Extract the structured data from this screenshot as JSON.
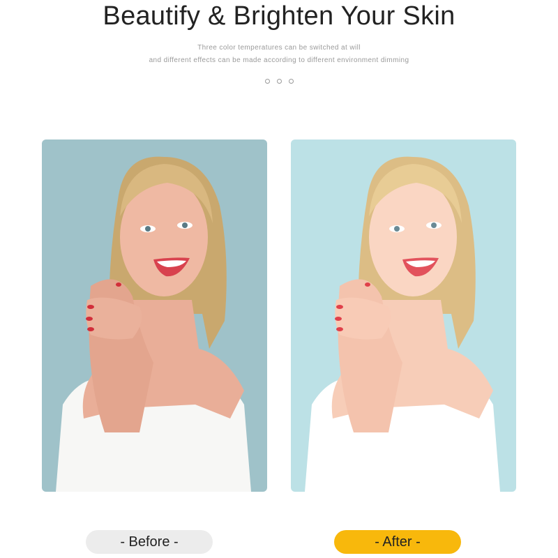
{
  "header": {
    "title": "Beautify & Brighten Your Skin",
    "subtitle_line1": "Three color temperatures can be switched at will",
    "subtitle_line2": "and different effects can be made according to different environment dimming"
  },
  "pager": {
    "dot_count": 3
  },
  "comparison": {
    "before": {
      "label": "- Before -",
      "bg_color": "#9fc2c9",
      "pill_color": "#ececec"
    },
    "after": {
      "label": "- After -",
      "bg_color": "#bce1e6",
      "pill_color": "#f8b80c"
    }
  },
  "icons": [
    "pager-dot-icon"
  ]
}
